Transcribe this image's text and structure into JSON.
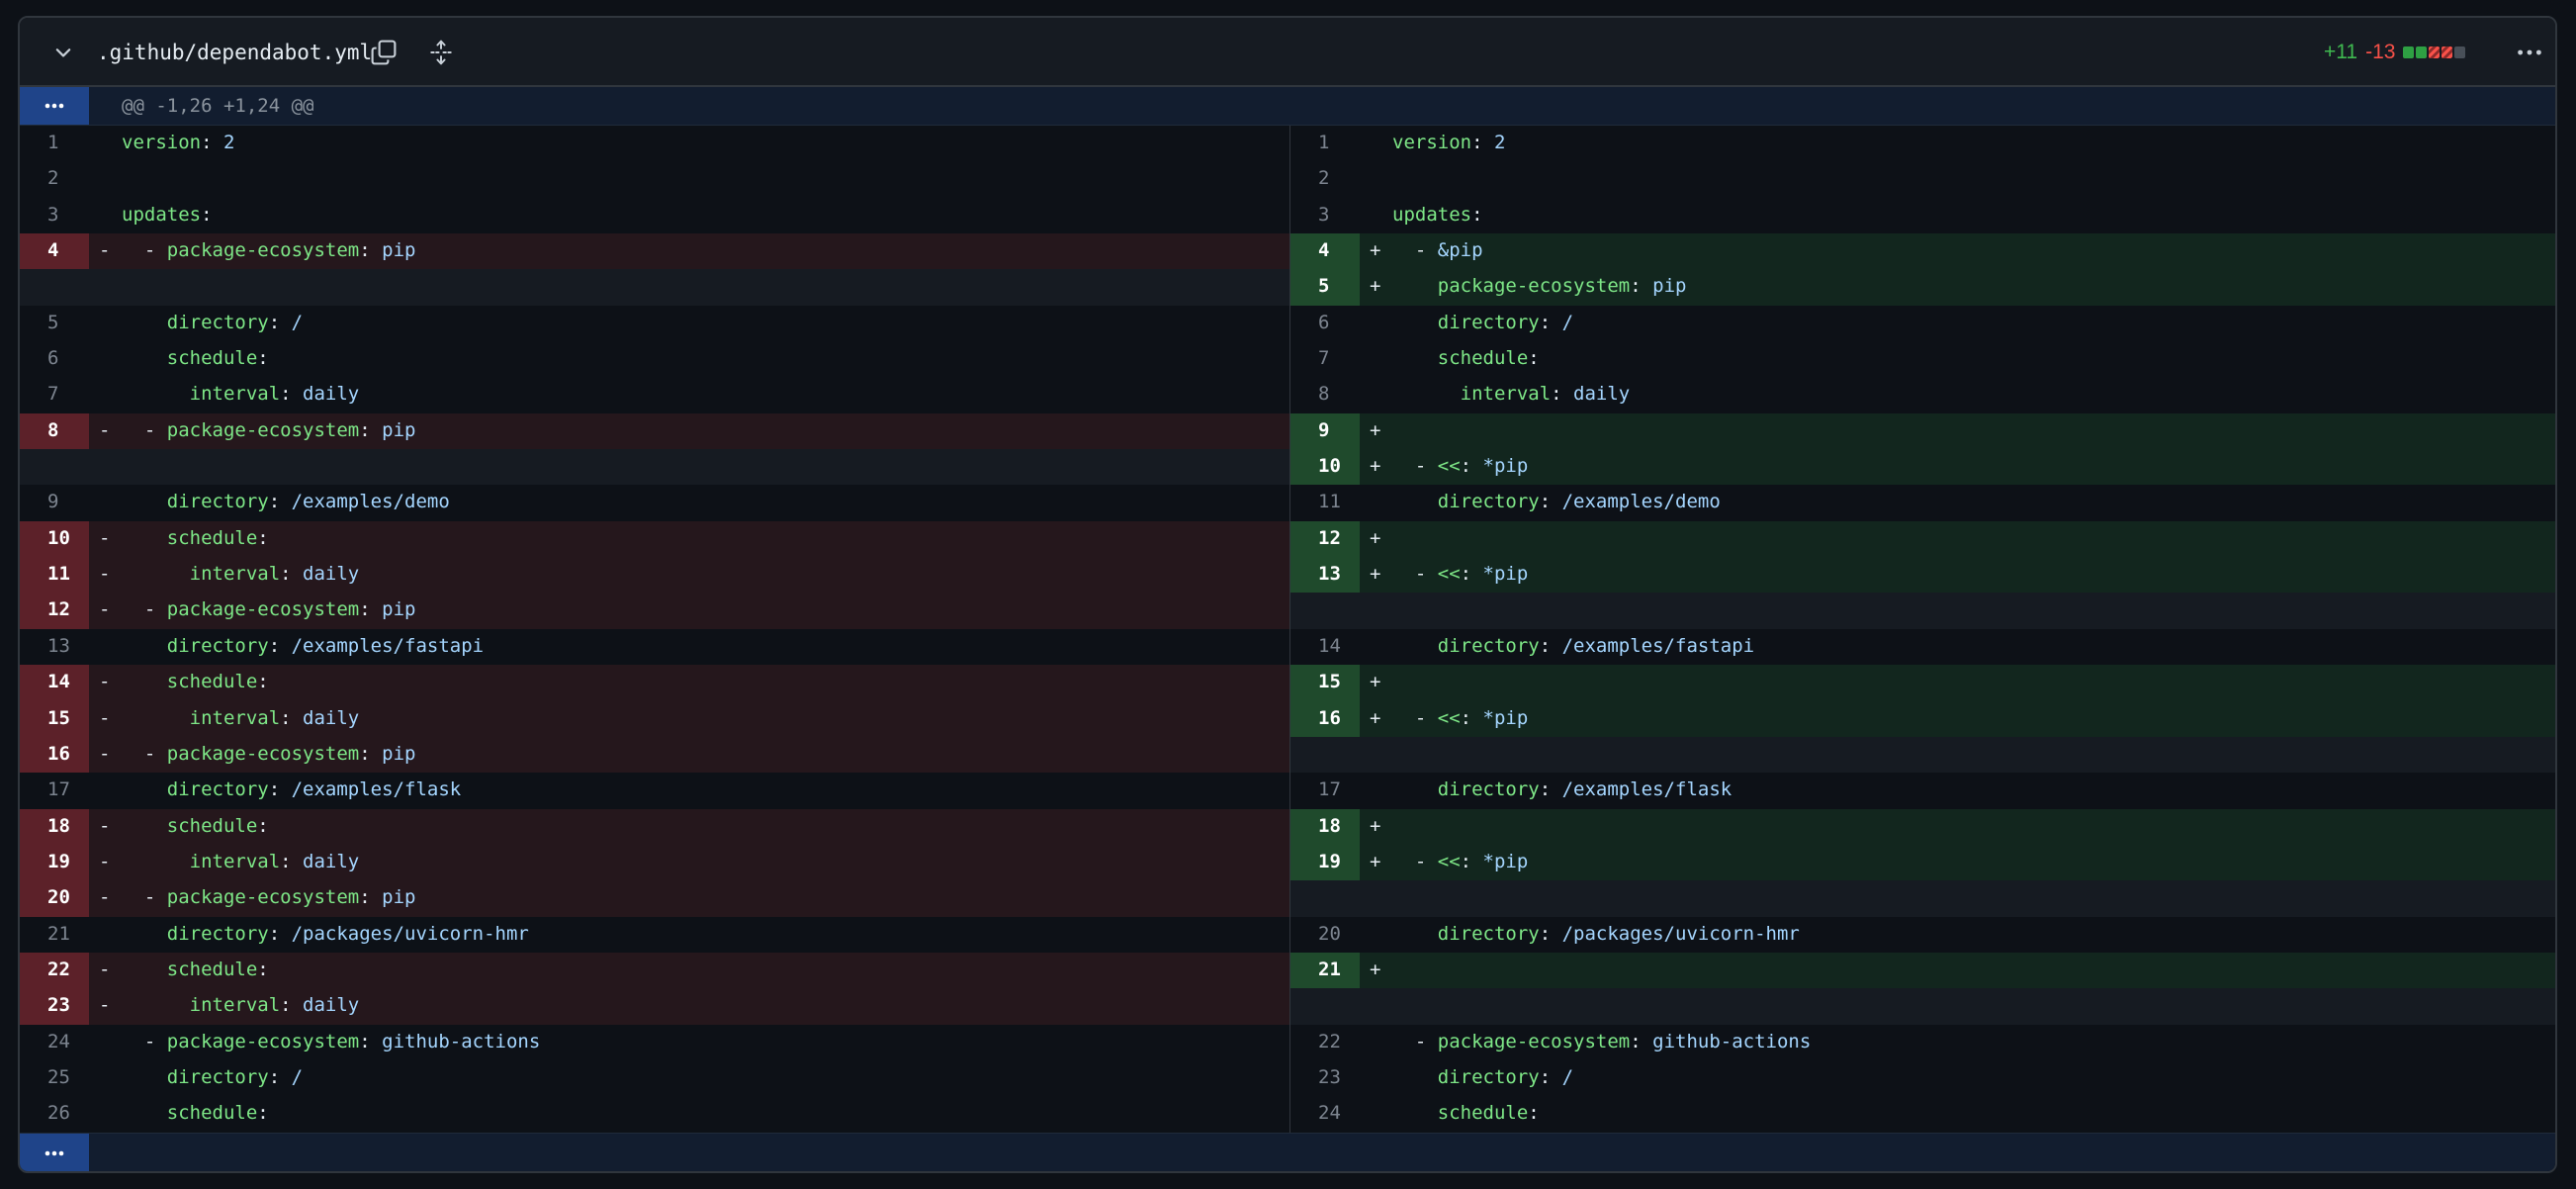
{
  "file": {
    "name": ".github/dependabot.yml",
    "additions": "+11",
    "deletions": "-13",
    "diffstat": [
      "added",
      "added",
      "deleted",
      "deleted",
      "neutral"
    ]
  },
  "hunk": {
    "header": "@@ -1,26 +1,24 @@"
  },
  "colors": {
    "background": "#0d1117",
    "addition": "#3fb950",
    "deletion": "#f85149",
    "expander": "#1f4489",
    "yaml_key": "#7ee787",
    "yaml_value": "#a5d6ff"
  },
  "rows": [
    {
      "h": 35,
      "l": {
        "t": "ctx",
        "n": "1",
        "c": [
          [
            "k",
            "version"
          ],
          [
            "p",
            ": "
          ],
          [
            "v",
            "2"
          ]
        ]
      },
      "r": {
        "t": "ctx",
        "n": "1",
        "c": [
          [
            "k",
            "version"
          ],
          [
            "p",
            ": "
          ],
          [
            "v",
            "2"
          ]
        ]
      }
    },
    {
      "h": 35,
      "l": {
        "t": "ctx",
        "n": "2",
        "c": []
      },
      "r": {
        "t": "ctx",
        "n": "2",
        "c": []
      }
    },
    {
      "h": 35,
      "l": {
        "t": "ctx",
        "n": "3",
        "c": [
          [
            "k",
            "updates"
          ],
          [
            "p",
            ":"
          ]
        ]
      },
      "r": {
        "t": "ctx",
        "n": "3",
        "c": [
          [
            "k",
            "updates"
          ],
          [
            "p",
            ":"
          ]
        ]
      }
    },
    {
      "h": 35,
      "l": {
        "t": "del",
        "n": "4",
        "c": [
          [
            "p",
            "  - "
          ],
          [
            "k",
            "package-ecosystem"
          ],
          [
            "p",
            ": "
          ],
          [
            "v",
            "pip"
          ]
        ]
      },
      "r": {
        "t": "add",
        "n": "4",
        "c": [
          [
            "p",
            "  - "
          ],
          [
            "v",
            "&pip"
          ]
        ]
      }
    },
    {
      "h": 35,
      "l": {
        "t": "empty"
      },
      "r": {
        "t": "add",
        "n": "5",
        "c": [
          [
            "p",
            "    "
          ],
          [
            "k",
            "package-ecosystem"
          ],
          [
            "p",
            ": "
          ],
          [
            "v",
            "pip"
          ]
        ]
      }
    },
    {
      "h": 35,
      "l": {
        "t": "ctx",
        "n": "5",
        "c": [
          [
            "p",
            "    "
          ],
          [
            "k",
            "directory"
          ],
          [
            "p",
            ": "
          ],
          [
            "v",
            "/"
          ]
        ]
      },
      "r": {
        "t": "ctx",
        "n": "6",
        "c": [
          [
            "p",
            "    "
          ],
          [
            "k",
            "directory"
          ],
          [
            "p",
            ": "
          ],
          [
            "v",
            "/"
          ]
        ]
      }
    },
    {
      "h": 35,
      "l": {
        "t": "ctx",
        "n": "6",
        "c": [
          [
            "p",
            "    "
          ],
          [
            "k",
            "schedule"
          ],
          [
            "p",
            ":"
          ]
        ]
      },
      "r": {
        "t": "ctx",
        "n": "7",
        "c": [
          [
            "p",
            "    "
          ],
          [
            "k",
            "schedule"
          ],
          [
            "p",
            ":"
          ]
        ]
      }
    },
    {
      "h": 35,
      "l": {
        "t": "ctx",
        "n": "7",
        "c": [
          [
            "p",
            "      "
          ],
          [
            "k",
            "interval"
          ],
          [
            "p",
            ": "
          ],
          [
            "v",
            "daily"
          ]
        ]
      },
      "r": {
        "t": "ctx",
        "n": "8",
        "c": [
          [
            "p",
            "      "
          ],
          [
            "k",
            "interval"
          ],
          [
            "p",
            ": "
          ],
          [
            "v",
            "daily"
          ]
        ]
      }
    },
    {
      "h": 35,
      "l": {
        "t": "del",
        "n": "8",
        "c": [
          [
            "p",
            "  - "
          ],
          [
            "k",
            "package-ecosystem"
          ],
          [
            "p",
            ": "
          ],
          [
            "v",
            "pip"
          ]
        ]
      },
      "r": {
        "t": "add",
        "n": "9",
        "c": []
      }
    },
    {
      "h": 35,
      "l": {
        "t": "empty"
      },
      "r": {
        "t": "add",
        "n": "10",
        "c": [
          [
            "p",
            "  - "
          ],
          [
            "k",
            "<<"
          ],
          [
            "p",
            ": "
          ],
          [
            "v",
            "*pip"
          ]
        ]
      }
    },
    {
      "h": 35,
      "l": {
        "t": "ctx",
        "n": "9",
        "c": [
          [
            "p",
            "    "
          ],
          [
            "k",
            "directory"
          ],
          [
            "p",
            ": "
          ],
          [
            "v",
            "/examples/demo"
          ]
        ]
      },
      "r": {
        "t": "ctx",
        "n": "11",
        "c": [
          [
            "p",
            "    "
          ],
          [
            "k",
            "directory"
          ],
          [
            "p",
            ": "
          ],
          [
            "v",
            "/examples/demo"
          ]
        ]
      }
    },
    {
      "h": 35,
      "l": {
        "t": "del",
        "n": "10",
        "c": [
          [
            "p",
            "    "
          ],
          [
            "k",
            "schedule"
          ],
          [
            "p",
            ":"
          ]
        ]
      },
      "r": {
        "t": "add",
        "n": "12",
        "c": []
      }
    },
    {
      "h": 35,
      "l": {
        "t": "del",
        "n": "11",
        "c": [
          [
            "p",
            "      "
          ],
          [
            "k",
            "interval"
          ],
          [
            "p",
            ": "
          ],
          [
            "v",
            "daily"
          ]
        ]
      },
      "r": {
        "t": "add",
        "n": "13",
        "c": [
          [
            "p",
            "  - "
          ],
          [
            "k",
            "<<"
          ],
          [
            "p",
            ": "
          ],
          [
            "v",
            "*pip"
          ]
        ]
      }
    },
    {
      "h": 35,
      "l": {
        "t": "del",
        "n": "12",
        "c": [
          [
            "p",
            "  - "
          ],
          [
            "k",
            "package-ecosystem"
          ],
          [
            "p",
            ": "
          ],
          [
            "v",
            "pip"
          ]
        ]
      },
      "r": {
        "t": "empty"
      }
    },
    {
      "h": 35,
      "l": {
        "t": "ctx",
        "n": "13",
        "c": [
          [
            "p",
            "    "
          ],
          [
            "k",
            "directory"
          ],
          [
            "p",
            ": "
          ],
          [
            "v",
            "/examples/fastapi"
          ]
        ]
      },
      "r": {
        "t": "ctx",
        "n": "14",
        "c": [
          [
            "p",
            "    "
          ],
          [
            "k",
            "directory"
          ],
          [
            "p",
            ": "
          ],
          [
            "v",
            "/examples/fastapi"
          ]
        ]
      }
    },
    {
      "h": 35,
      "l": {
        "t": "del",
        "n": "14",
        "c": [
          [
            "p",
            "    "
          ],
          [
            "k",
            "schedule"
          ],
          [
            "p",
            ":"
          ]
        ]
      },
      "r": {
        "t": "add",
        "n": "15",
        "c": []
      }
    },
    {
      "h": 35,
      "l": {
        "t": "del",
        "n": "15",
        "c": [
          [
            "p",
            "      "
          ],
          [
            "k",
            "interval"
          ],
          [
            "p",
            ": "
          ],
          [
            "v",
            "daily"
          ]
        ]
      },
      "r": {
        "t": "add",
        "n": "16",
        "c": [
          [
            "p",
            "  - "
          ],
          [
            "k",
            "<<"
          ],
          [
            "p",
            ": "
          ],
          [
            "v",
            "*pip"
          ]
        ]
      }
    },
    {
      "h": 35,
      "l": {
        "t": "del",
        "n": "16",
        "c": [
          [
            "p",
            "  - "
          ],
          [
            "k",
            "package-ecosystem"
          ],
          [
            "p",
            ": "
          ],
          [
            "v",
            "pip"
          ]
        ]
      },
      "r": {
        "t": "empty"
      }
    },
    {
      "h": 35,
      "l": {
        "t": "ctx",
        "n": "17",
        "c": [
          [
            "p",
            "    "
          ],
          [
            "k",
            "directory"
          ],
          [
            "p",
            ": "
          ],
          [
            "v",
            "/examples/flask"
          ]
        ]
      },
      "r": {
        "t": "ctx",
        "n": "17",
        "c": [
          [
            "p",
            "    "
          ],
          [
            "k",
            "directory"
          ],
          [
            "p",
            ": "
          ],
          [
            "v",
            "/examples/flask"
          ]
        ]
      }
    },
    {
      "h": 35,
      "l": {
        "t": "del",
        "n": "18",
        "c": [
          [
            "p",
            "    "
          ],
          [
            "k",
            "schedule"
          ],
          [
            "p",
            ":"
          ]
        ]
      },
      "r": {
        "t": "add",
        "n": "18",
        "c": []
      }
    },
    {
      "h": 35,
      "l": {
        "t": "del",
        "n": "19",
        "c": [
          [
            "p",
            "      "
          ],
          [
            "k",
            "interval"
          ],
          [
            "p",
            ": "
          ],
          [
            "v",
            "daily"
          ]
        ]
      },
      "r": {
        "t": "add",
        "n": "19",
        "c": [
          [
            "p",
            "  - "
          ],
          [
            "k",
            "<<"
          ],
          [
            "p",
            ": "
          ],
          [
            "v",
            "*pip"
          ]
        ]
      }
    },
    {
      "h": 35,
      "l": {
        "t": "del",
        "n": "20",
        "c": [
          [
            "p",
            "  - "
          ],
          [
            "k",
            "package-ecosystem"
          ],
          [
            "p",
            ": "
          ],
          [
            "v",
            "pip"
          ]
        ]
      },
      "r": {
        "t": "empty"
      }
    },
    {
      "h": 35,
      "l": {
        "t": "ctx",
        "n": "21",
        "c": [
          [
            "p",
            "    "
          ],
          [
            "k",
            "directory"
          ],
          [
            "p",
            ": "
          ],
          [
            "v",
            "/packages/uvicorn-hmr"
          ]
        ]
      },
      "r": {
        "t": "ctx",
        "n": "20",
        "c": [
          [
            "p",
            "    "
          ],
          [
            "k",
            "directory"
          ],
          [
            "p",
            ": "
          ],
          [
            "v",
            "/packages/uvicorn-hmr"
          ]
        ]
      }
    },
    {
      "h": 35,
      "l": {
        "t": "del",
        "n": "22",
        "c": [
          [
            "p",
            "    "
          ],
          [
            "k",
            "schedule"
          ],
          [
            "p",
            ":"
          ]
        ]
      },
      "r": {
        "t": "add",
        "n": "21",
        "c": []
      }
    },
    {
      "h": 35,
      "l": {
        "t": "del",
        "n": "23",
        "c": [
          [
            "p",
            "      "
          ],
          [
            "k",
            "interval"
          ],
          [
            "p",
            ": "
          ],
          [
            "v",
            "daily"
          ]
        ]
      },
      "r": {
        "t": "empty"
      }
    },
    {
      "h": 35,
      "l": {
        "t": "ctx",
        "n": "24",
        "c": [
          [
            "p",
            "  - "
          ],
          [
            "k",
            "package-ecosystem"
          ],
          [
            "p",
            ": "
          ],
          [
            "v",
            "github-actions"
          ]
        ]
      },
      "r": {
        "t": "ctx",
        "n": "22",
        "c": [
          [
            "p",
            "  - "
          ],
          [
            "k",
            "package-ecosystem"
          ],
          [
            "p",
            ": "
          ],
          [
            "v",
            "github-actions"
          ]
        ]
      }
    },
    {
      "h": 35,
      "l": {
        "t": "ctx",
        "n": "25",
        "c": [
          [
            "p",
            "    "
          ],
          [
            "k",
            "directory"
          ],
          [
            "p",
            ": "
          ],
          [
            "v",
            "/"
          ]
        ]
      },
      "r": {
        "t": "ctx",
        "n": "23",
        "c": [
          [
            "p",
            "    "
          ],
          [
            "k",
            "directory"
          ],
          [
            "p",
            ": "
          ],
          [
            "v",
            "/"
          ]
        ]
      }
    },
    {
      "h": 35,
      "l": {
        "t": "ctx",
        "n": "26",
        "c": [
          [
            "p",
            "    "
          ],
          [
            "k",
            "schedule"
          ],
          [
            "p",
            ":"
          ]
        ]
      },
      "r": {
        "t": "ctx",
        "n": "24",
        "c": [
          [
            "p",
            "    "
          ],
          [
            "k",
            "schedule"
          ],
          [
            "p",
            ":"
          ]
        ]
      }
    }
  ]
}
